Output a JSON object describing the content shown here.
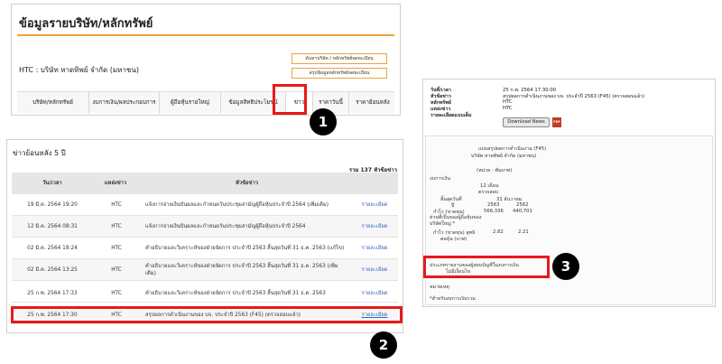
{
  "panel1": {
    "title": "ข้อมูลรายบริษัท/หลักทรัพย์",
    "company": "HTC : บริษัท หาดทิพย์ จำกัด (มหาชน)",
    "buttons": [
      "ค้นหาบริษัท / หลักทรัพย์จดทะเบียน",
      "สรุปข้อมูลหลักทรัพย์จดทะเบียน"
    ],
    "tabs": [
      "บริษัท/หลักทรัพย์",
      "งบการเงิน/ผลประกอบการ",
      "ผู้ถือหุ้นรายใหญ่",
      "ข้อมูลสิทธิประโยชน์",
      "ข่าว",
      "ราคาวันนี้",
      "ราคาย้อนหลัง"
    ]
  },
  "markers": [
    "1",
    "2",
    "3"
  ],
  "panel2": {
    "title": "ข่าวย้อนหลัง 5 ปี",
    "total": "รวม 137 หัวข้อข่าว",
    "headers": {
      "date": "วัน/เวลา",
      "source": "แหล่งข่าว",
      "headline": "หัวข้อข่าว"
    },
    "rows": [
      {
        "date": "19 มี.ค. 2564 19:20",
        "source": "HTC",
        "headline": "แจ้งการจ่ายเงินปันผลและกำหนดวันประชุมสามัญผู้ถือหุ้นประจำปี 2564 (เพิ่มเติม)",
        "link": "รายละเอียด"
      },
      {
        "date": "12 มี.ค. 2564 08:31",
        "source": "HTC",
        "headline": "แจ้งการจ่ายเงินปันผลและกำหนดวันประชุมสามัญผู้ถือหุ้นประจำปี 2564",
        "link": "รายละเอียด"
      },
      {
        "date": "02 มี.ค. 2564 18:24",
        "source": "HTC",
        "headline": "คำอธิบายและวิเคราะห์ของฝ่ายจัดการ ประจำปี 2563 สิ้นสุดวันที่ 31 ธ.ค. 2563 (แก้ไข)",
        "link": "รายละเอียด"
      },
      {
        "date": "02 มี.ค. 2564 13:25",
        "source": "HTC",
        "headline": "คำอธิบายและวิเคราะห์ของฝ่ายจัดการ ประจำปี 2563 สิ้นสุดวันที่ 31 ธ.ค. 2563 (เพิ่มเติม)",
        "link": "รายละเอียด"
      },
      {
        "date": "25 ก.พ. 2564 17:33",
        "source": "HTC",
        "headline": "คำอธิบายและวิเคราะห์ของฝ่ายจัดการ ประจำปี 2563 สิ้นสุดวันที่ 31 ธ.ค. 2563",
        "link": "รายละเอียด"
      },
      {
        "date": "25 ก.พ. 2564 17:30",
        "source": "HTC",
        "headline": "สรุปผลการดำเนินงานของ บจ. ประจำปี 2563 (F45) (ตรวจสอบแล้ว)",
        "link": "รายละเอียด"
      }
    ]
  },
  "panel3": {
    "meta": [
      {
        "label": "วันที่/เวลา",
        "value": "25 ก.พ. 2564 17:30:00"
      },
      {
        "label": "หัวข้อข่าว",
        "value": "สรุปผลการดำเนินงานของ บจ. ประจำปี 2563 (F45) (ตรวจสอบแล้ว)"
      },
      {
        "label": "หลักทรัพย์",
        "value": "HTC"
      },
      {
        "label": "แหล่งข่าว",
        "value": "HTC"
      },
      {
        "label": "รายละเอียดแบบเต็ม",
        "value": ""
      }
    ],
    "download_label": "Download News",
    "pdf_label": "PDF",
    "form_title": "แบบสรุปผลการดำเนินงาน (F45)",
    "form_company": "บริษัท หาดทิพย์ จำกัด (มหาชน)",
    "unit": "(หน่วย : พันบาท)",
    "statement": "งบการเงิน",
    "period": "12 เดือน",
    "audited": "ตรวจสอบ",
    "period_end_label": "สิ้นสุดวันที่",
    "period_end_date": "31 ธันวาคม",
    "year_label": "ปี",
    "years": [
      "2563",
      "2562"
    ],
    "profit_label": "กำไร (ขาดทุน)",
    "profit_values": [
      "566,336",
      "440,701"
    ],
    "profit_sub": "ส่วนที่เป็นของผู้ถือหุ้นของบริษัทใหญ่ *",
    "eps_label": "กำไร (ขาดทุน) สุทธิ",
    "eps_sub": "ต่อหุ้น (บาท)",
    "eps_values": [
      "2.82",
      "2.21"
    ],
    "opinion_line1": "ประเภทรายงานของผู้สอบบัญชีในงบการเงิน",
    "opinion_line2": "ไม่มีเงื่อนไข",
    "remark": "หมายเหตุ",
    "footnote": "*สำหรับงบการเงินรวม"
  }
}
